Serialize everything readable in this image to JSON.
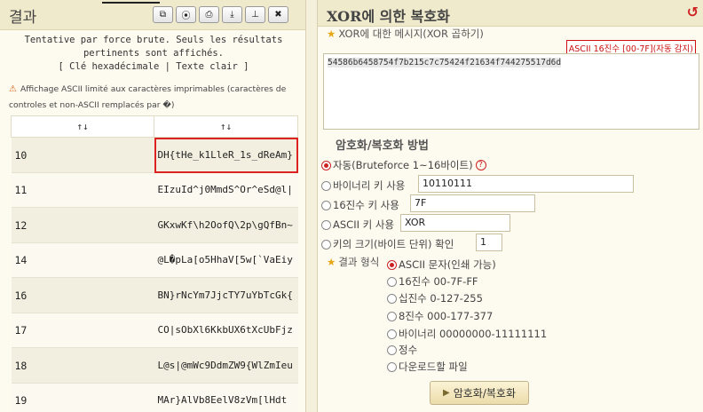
{
  "left": {
    "title": "결과",
    "tools": [
      "⧉",
      "⦿",
      "⎙",
      "⤓",
      "⊥",
      "✖"
    ],
    "info_line1": "Tentative par force brute. Seuls les résultats",
    "info_line2": "pertinents sont affichés.",
    "info_line3": "[ Clé hexadécimale | Texte clair ]",
    "warning_icon": "⚠",
    "warning": "Affichage ASCII limité aux caractères imprimables (caractères de controles et non-ASCII remplacés par �)",
    "sort_col1": "↑↓",
    "sort_col2": "↑↓",
    "rows": [
      {
        "key": "10",
        "text": "DH{tHe_k1LleR_1s_dReAm}"
      },
      {
        "key": "11",
        "text": "EIzuId^j0MmdS^Or^eSd@l|"
      },
      {
        "key": "12",
        "text": "GKxwKf\\h2OofQ\\2p\\gQfBn~"
      },
      {
        "key": "14",
        "text": "@L�pLa[o5HhaV[5w[`VaEiy"
      },
      {
        "key": "16",
        "text": "BN}rNcYm7JjcTY7uYbTcGk{"
      },
      {
        "key": "17",
        "text": "CO|sObXl6KkbUX6tXcUbFjz"
      },
      {
        "key": "18",
        "text": "L@s|@mWc9DdmZW9{WlZmIeu"
      },
      {
        "key": "19",
        "text": "MAr}AlVb8EelV8zVm[lHdt"
      }
    ]
  },
  "right": {
    "title": "XOR에 의한 복호화",
    "reload_icon": "↺",
    "message_label": "XOR에 대한 메시지(XOR 곱하기)",
    "detect_badge": "ASCII 16진수 [00-7F](자동 감지)",
    "message_value": "54586b6458754f7b215c7c75424f21634f744275517d6d",
    "method_title": "암호화/복호화 방법",
    "options": {
      "auto": "자동(Bruteforce 1~16바이트)",
      "binary_key": "바이너리 키 사용",
      "binary_value": "10110111",
      "hex_key": "16진수 키 사용",
      "hex_value": "7F",
      "ascii_key": "ASCII 키 사용",
      "ascii_value": "XOR",
      "key_size": "키의 크기(바이트 단위) 확인",
      "key_size_value": "1"
    },
    "format_label": "결과 형식",
    "formats": [
      "ASCII 문자(인쇄 가능)",
      "16진수 00-7F-FF",
      "십진수 0-127-255",
      "8진수 000-177-377",
      "바이너리 00000000-11111111",
      "정수",
      "다운로드할 파일"
    ],
    "submit": "암호화/복호화"
  }
}
